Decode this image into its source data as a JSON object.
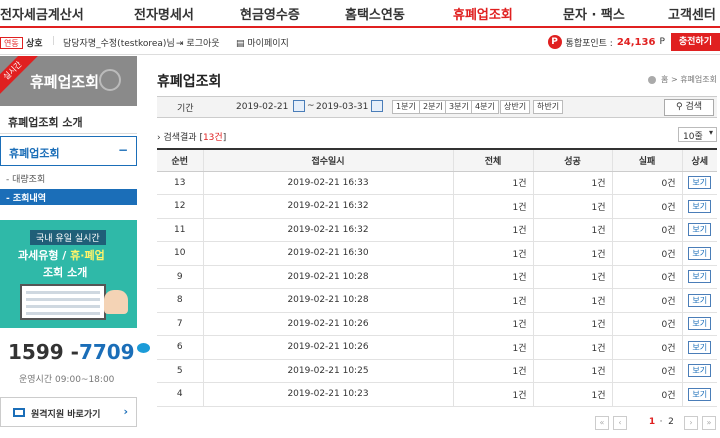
{
  "nav": {
    "items": [
      {
        "label": "전자세금계산서",
        "active": false
      },
      {
        "label": "전자명세서",
        "active": false
      },
      {
        "label": "현금영수증",
        "active": false
      },
      {
        "label": "홈택스연동",
        "active": false
      },
      {
        "label": "휴폐업조회",
        "active": true
      },
      {
        "label": "문자 · 팩스",
        "active": false
      },
      {
        "label": "고객센터",
        "active": false
      }
    ]
  },
  "subbar": {
    "badge": "연동",
    "biz_label": "상호",
    "sep": "|",
    "person": "담당자명_수정(testkorea)님",
    "logout": "로그아웃",
    "mypage": "마이페이지",
    "point_icon": "P",
    "point_label": "통합포인트 :",
    "point_value": "24,136",
    "point_unit": "P",
    "charge": "충전하기"
  },
  "sidebar": {
    "ribbon": "실시간",
    "title": "휴폐업조회",
    "menu_intro": "휴폐업조회 소개",
    "menu_main": "휴폐업조회",
    "menu_minus": "−",
    "sub_bulk": "- 대량조회",
    "sub_history": "- 조회내역",
    "promo_line1": "국내 유일 실시간",
    "promo_line2_pre": "과세유형 / ",
    "promo_line2_hl": "휴·폐업",
    "promo_line3": "조회 소개",
    "phone_pre": "1599 -",
    "phone_post": "7709",
    "hours": "운영시간 09:00~18:00",
    "remote": "원격지원 바로가기",
    "remote_arrow": "›"
  },
  "main": {
    "title": "휴폐업조회",
    "breadcrumb_home": "홈",
    "breadcrumb_sep": ">",
    "breadcrumb_current": "휴폐업조회",
    "search": {
      "label": "기간",
      "start": "2019-02-21",
      "tilde": "~",
      "end": "2019-03-31",
      "quick": [
        "1분기",
        "2분기",
        "3분기",
        "4분기",
        "상반기",
        "하반기"
      ],
      "button": "검색"
    },
    "result_prefix": "› 검색결과 [",
    "result_count": "13건",
    "result_suffix": "]",
    "page_size": "10줄"
  },
  "table": {
    "headers": [
      "순번",
      "접수일시",
      "전체",
      "성공",
      "실패",
      "상세"
    ],
    "rows": [
      {
        "no": "13",
        "date": "2019-02-21 16:33",
        "total": "1건",
        "success": "1건",
        "fail": "0건",
        "detail": "보기"
      },
      {
        "no": "12",
        "date": "2019-02-21 16:32",
        "total": "1건",
        "success": "1건",
        "fail": "0건",
        "detail": "보기"
      },
      {
        "no": "11",
        "date": "2019-02-21 16:32",
        "total": "1건",
        "success": "1건",
        "fail": "0건",
        "detail": "보기"
      },
      {
        "no": "10",
        "date": "2019-02-21 16:30",
        "total": "1건",
        "success": "1건",
        "fail": "0건",
        "detail": "보기"
      },
      {
        "no": "9",
        "date": "2019-02-21 10:28",
        "total": "1건",
        "success": "1건",
        "fail": "0건",
        "detail": "보기"
      },
      {
        "no": "8",
        "date": "2019-02-21 10:28",
        "total": "1건",
        "success": "1건",
        "fail": "0건",
        "detail": "보기"
      },
      {
        "no": "7",
        "date": "2019-02-21 10:26",
        "total": "1건",
        "success": "1건",
        "fail": "0건",
        "detail": "보기"
      },
      {
        "no": "6",
        "date": "2019-02-21 10:26",
        "total": "1건",
        "success": "1건",
        "fail": "0건",
        "detail": "보기"
      },
      {
        "no": "5",
        "date": "2019-02-21 10:25",
        "total": "1건",
        "success": "1건",
        "fail": "0건",
        "detail": "보기"
      },
      {
        "no": "4",
        "date": "2019-02-21 10:23",
        "total": "1건",
        "success": "1건",
        "fail": "0건",
        "detail": "보기"
      }
    ]
  },
  "pager": {
    "first": "«",
    "prev": "‹",
    "pages": [
      "1",
      "2"
    ],
    "dot": "·",
    "next": "›",
    "last": "»"
  },
  "colors": {
    "accent": "#e02020",
    "blue": "#1b6eb8",
    "promo": "#2fb9a8"
  }
}
